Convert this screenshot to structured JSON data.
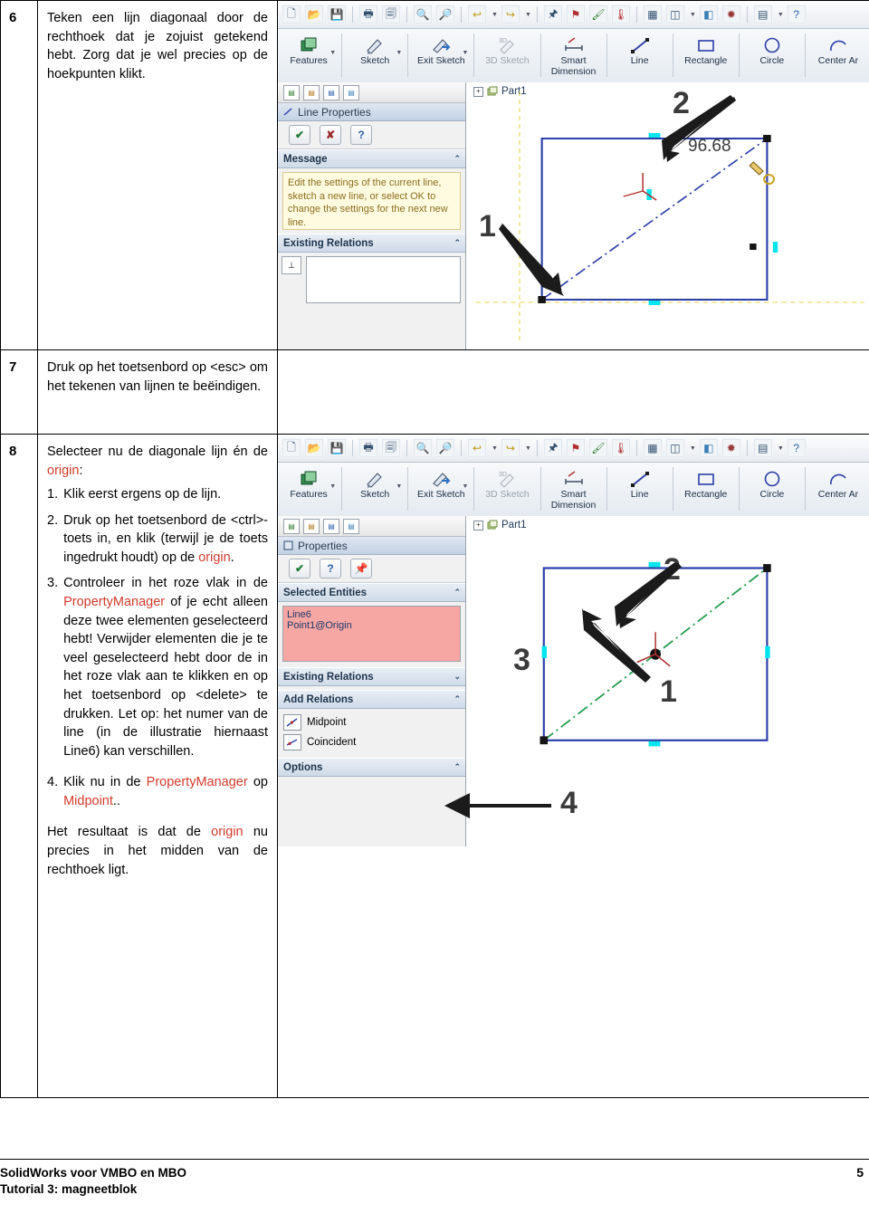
{
  "document": {
    "footer": {
      "line1": "SolidWorks voor VMBO en MBO",
      "line2": "Tutorial 3: magneetblok",
      "page_number": "5"
    }
  },
  "steps": [
    {
      "number": "6",
      "text": "Teken een lijn diagonaal door de rechthoek dat je zojuist getekend hebt. Zorg dat je wel precies op de hoekpunten klikt."
    },
    {
      "number": "7",
      "text": "Druk op het toetsenbord op <esc> om het tekenen van lijnen te beëindigen."
    },
    {
      "number": "8",
      "intro_a": "Selecteer nu de diagonale lijn én de ",
      "intro_origin": "origin",
      "intro_b": ":",
      "sub": [
        {
          "n": "1.",
          "parts": [
            {
              "t": "Klik eerst ergens op de lijn.",
              "c": "black"
            }
          ]
        },
        {
          "n": "2.",
          "parts": [
            {
              "t": "Druk op het toetsenbord de <ctrl>-toets in, en klik (terwijl je de toets ingedrukt houdt) op de ",
              "c": "black"
            },
            {
              "t": "origin",
              "c": "red"
            },
            {
              "t": ".",
              "c": "black"
            }
          ]
        },
        {
          "n": "3.",
          "parts": [
            {
              "t": "Controleer in het roze vlak in de ",
              "c": "black"
            },
            {
              "t": "PropertyManager",
              "c": "red"
            },
            {
              "t": " of je echt alleen deze twee elementen geselecteerd hebt! Verwijder elementen die je te veel geselecteerd hebt door de in het roze vlak aan te klikken en op het toetsenbord op <delete> te drukken. Let op: het numer van de line (in de illustratie hiernaast Line6) kan verschillen.",
              "c": "black"
            }
          ]
        },
        {
          "n": "4.",
          "parts": [
            {
              "t": "Klik nu in de ",
              "c": "black"
            },
            {
              "t": "PropertyManager",
              "c": "red"
            },
            {
              "t": " op ",
              "c": "black"
            },
            {
              "t": "Midpoint",
              "c": "red"
            },
            {
              "t": "..",
              "c": "black"
            }
          ]
        }
      ],
      "closing_a": "Het resultaat is dat de ",
      "closing_origin": "origin",
      "closing_b": " nu precies in het midden van de rechthoek ligt."
    }
  ],
  "screenshot_top": {
    "ribbon": [
      {
        "label": "Features",
        "icon": "features-icon",
        "dropdown": true
      },
      {
        "label": "Sketch",
        "icon": "sketch-icon",
        "dropdown": true
      },
      {
        "label": "Exit Sketch",
        "icon": "exit-sketch-icon",
        "dropdown": true
      },
      {
        "label": "3D Sketch",
        "icon": "3d-sketch-icon",
        "dropdown": false
      },
      {
        "label": "Smart Dimension",
        "icon": "smart-dimension-icon",
        "dropdown": false
      },
      {
        "label": "Line",
        "icon": "line-icon",
        "dropdown": false
      },
      {
        "label": "Rectangle",
        "icon": "rectangle-icon",
        "dropdown": false
      },
      {
        "label": "Circle",
        "icon": "circle-icon",
        "dropdown": false
      },
      {
        "label": "Center Ar",
        "icon": "centerpoint-arc-icon",
        "dropdown": false
      }
    ],
    "panel_title": "Line Properties",
    "tree_item": "Part1",
    "sections": [
      {
        "title": "Message",
        "body": "Edit the settings of the current line, sketch a new line, or select OK to change the settings for the next new line."
      },
      {
        "title": "Existing Relations",
        "body": ""
      }
    ],
    "callouts": [
      {
        "label": "1"
      },
      {
        "label": "2"
      }
    ],
    "dimension_label": "96.68"
  },
  "screenshot_bottom": {
    "ribbon": [
      {
        "label": "Features",
        "icon": "features-icon",
        "dropdown": true
      },
      {
        "label": "Sketch",
        "icon": "sketch-icon",
        "dropdown": true
      },
      {
        "label": "Exit Sketch",
        "icon": "exit-sketch-icon",
        "dropdown": true
      },
      {
        "label": "3D Sketch",
        "icon": "3d-sketch-icon",
        "dropdown": false
      },
      {
        "label": "Smart Dimension",
        "icon": "smart-dimension-icon",
        "dropdown": false
      },
      {
        "label": "Line",
        "icon": "line-icon",
        "dropdown": false
      },
      {
        "label": "Rectangle",
        "icon": "rectangle-icon",
        "dropdown": false
      },
      {
        "label": "Circle",
        "icon": "circle-icon",
        "dropdown": false
      },
      {
        "label": "Center Ar",
        "icon": "centerpoint-arc-icon",
        "dropdown": false
      }
    ],
    "panel_title": "Properties",
    "tree_item": "Part1",
    "sections": [
      {
        "title": "Selected Entities",
        "items": [
          "Line6",
          "Point1@Origin"
        ]
      },
      {
        "title": "Existing Relations",
        "items": []
      },
      {
        "title": "Add Relations",
        "items": [
          "Midpoint",
          "Coincident"
        ]
      },
      {
        "title": "Options",
        "items": []
      }
    ],
    "callouts": [
      {
        "label": "1"
      },
      {
        "label": "2"
      },
      {
        "label": "3"
      },
      {
        "label": "4"
      }
    ]
  },
  "colors": {
    "accent_red": "#d23b2c",
    "sketch_blue": "#2b3ea8",
    "relation_green": "#1f9b4a",
    "selection_pink": "#f6a6a3",
    "message_yellow": "#fffbe0",
    "cyan_handle": "#00e5ee"
  }
}
